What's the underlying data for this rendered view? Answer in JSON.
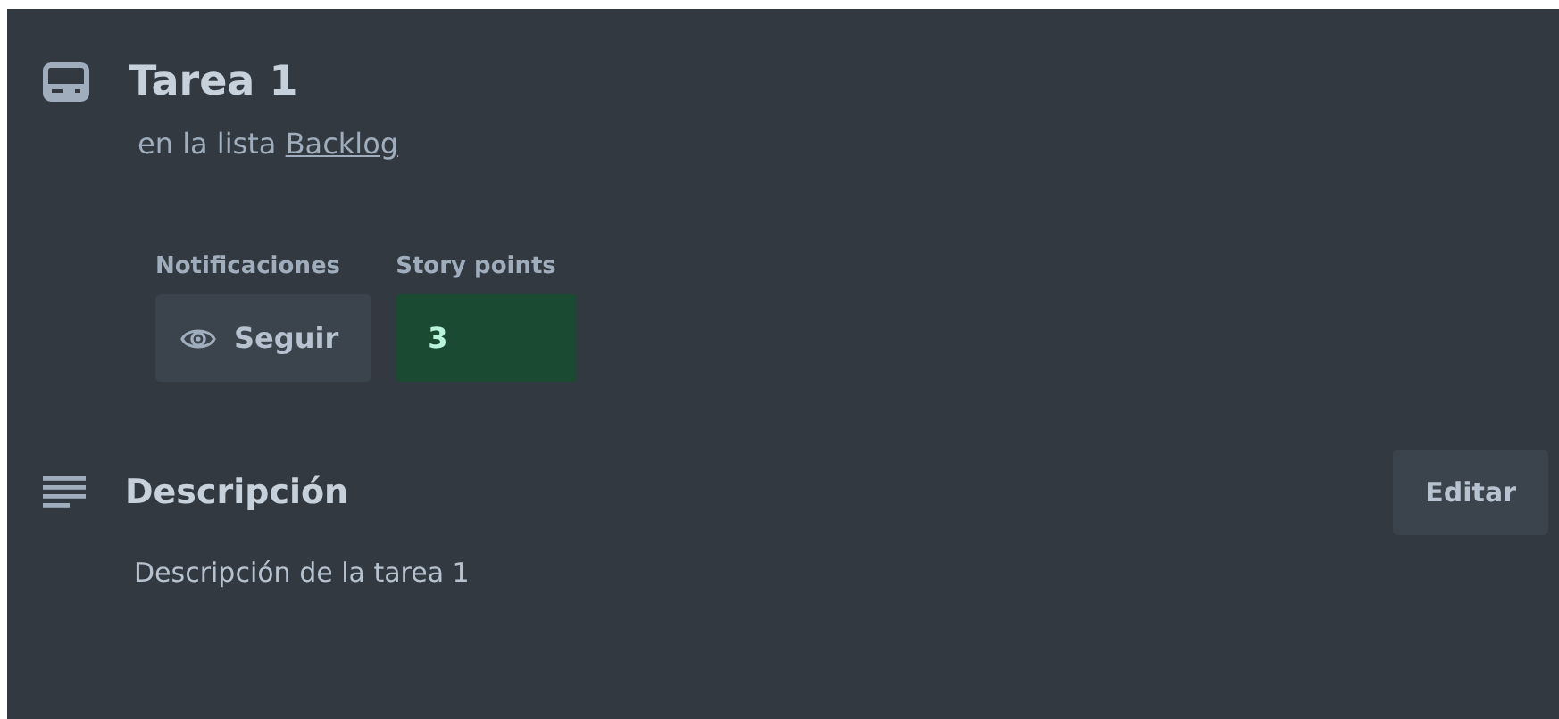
{
  "card": {
    "title": "Tarea 1",
    "list_prefix": "en la lista",
    "list_name": "Backlog"
  },
  "fields": [
    {
      "kind": "button",
      "label": "Notificaciones",
      "value": "Seguir"
    },
    {
      "kind": "value",
      "label": "Story points",
      "value": "3",
      "color": "#1b4a33"
    }
  ],
  "description": {
    "heading": "Descripción",
    "edit_button": "Editar",
    "text": "Descripción de la tarea 1"
  }
}
